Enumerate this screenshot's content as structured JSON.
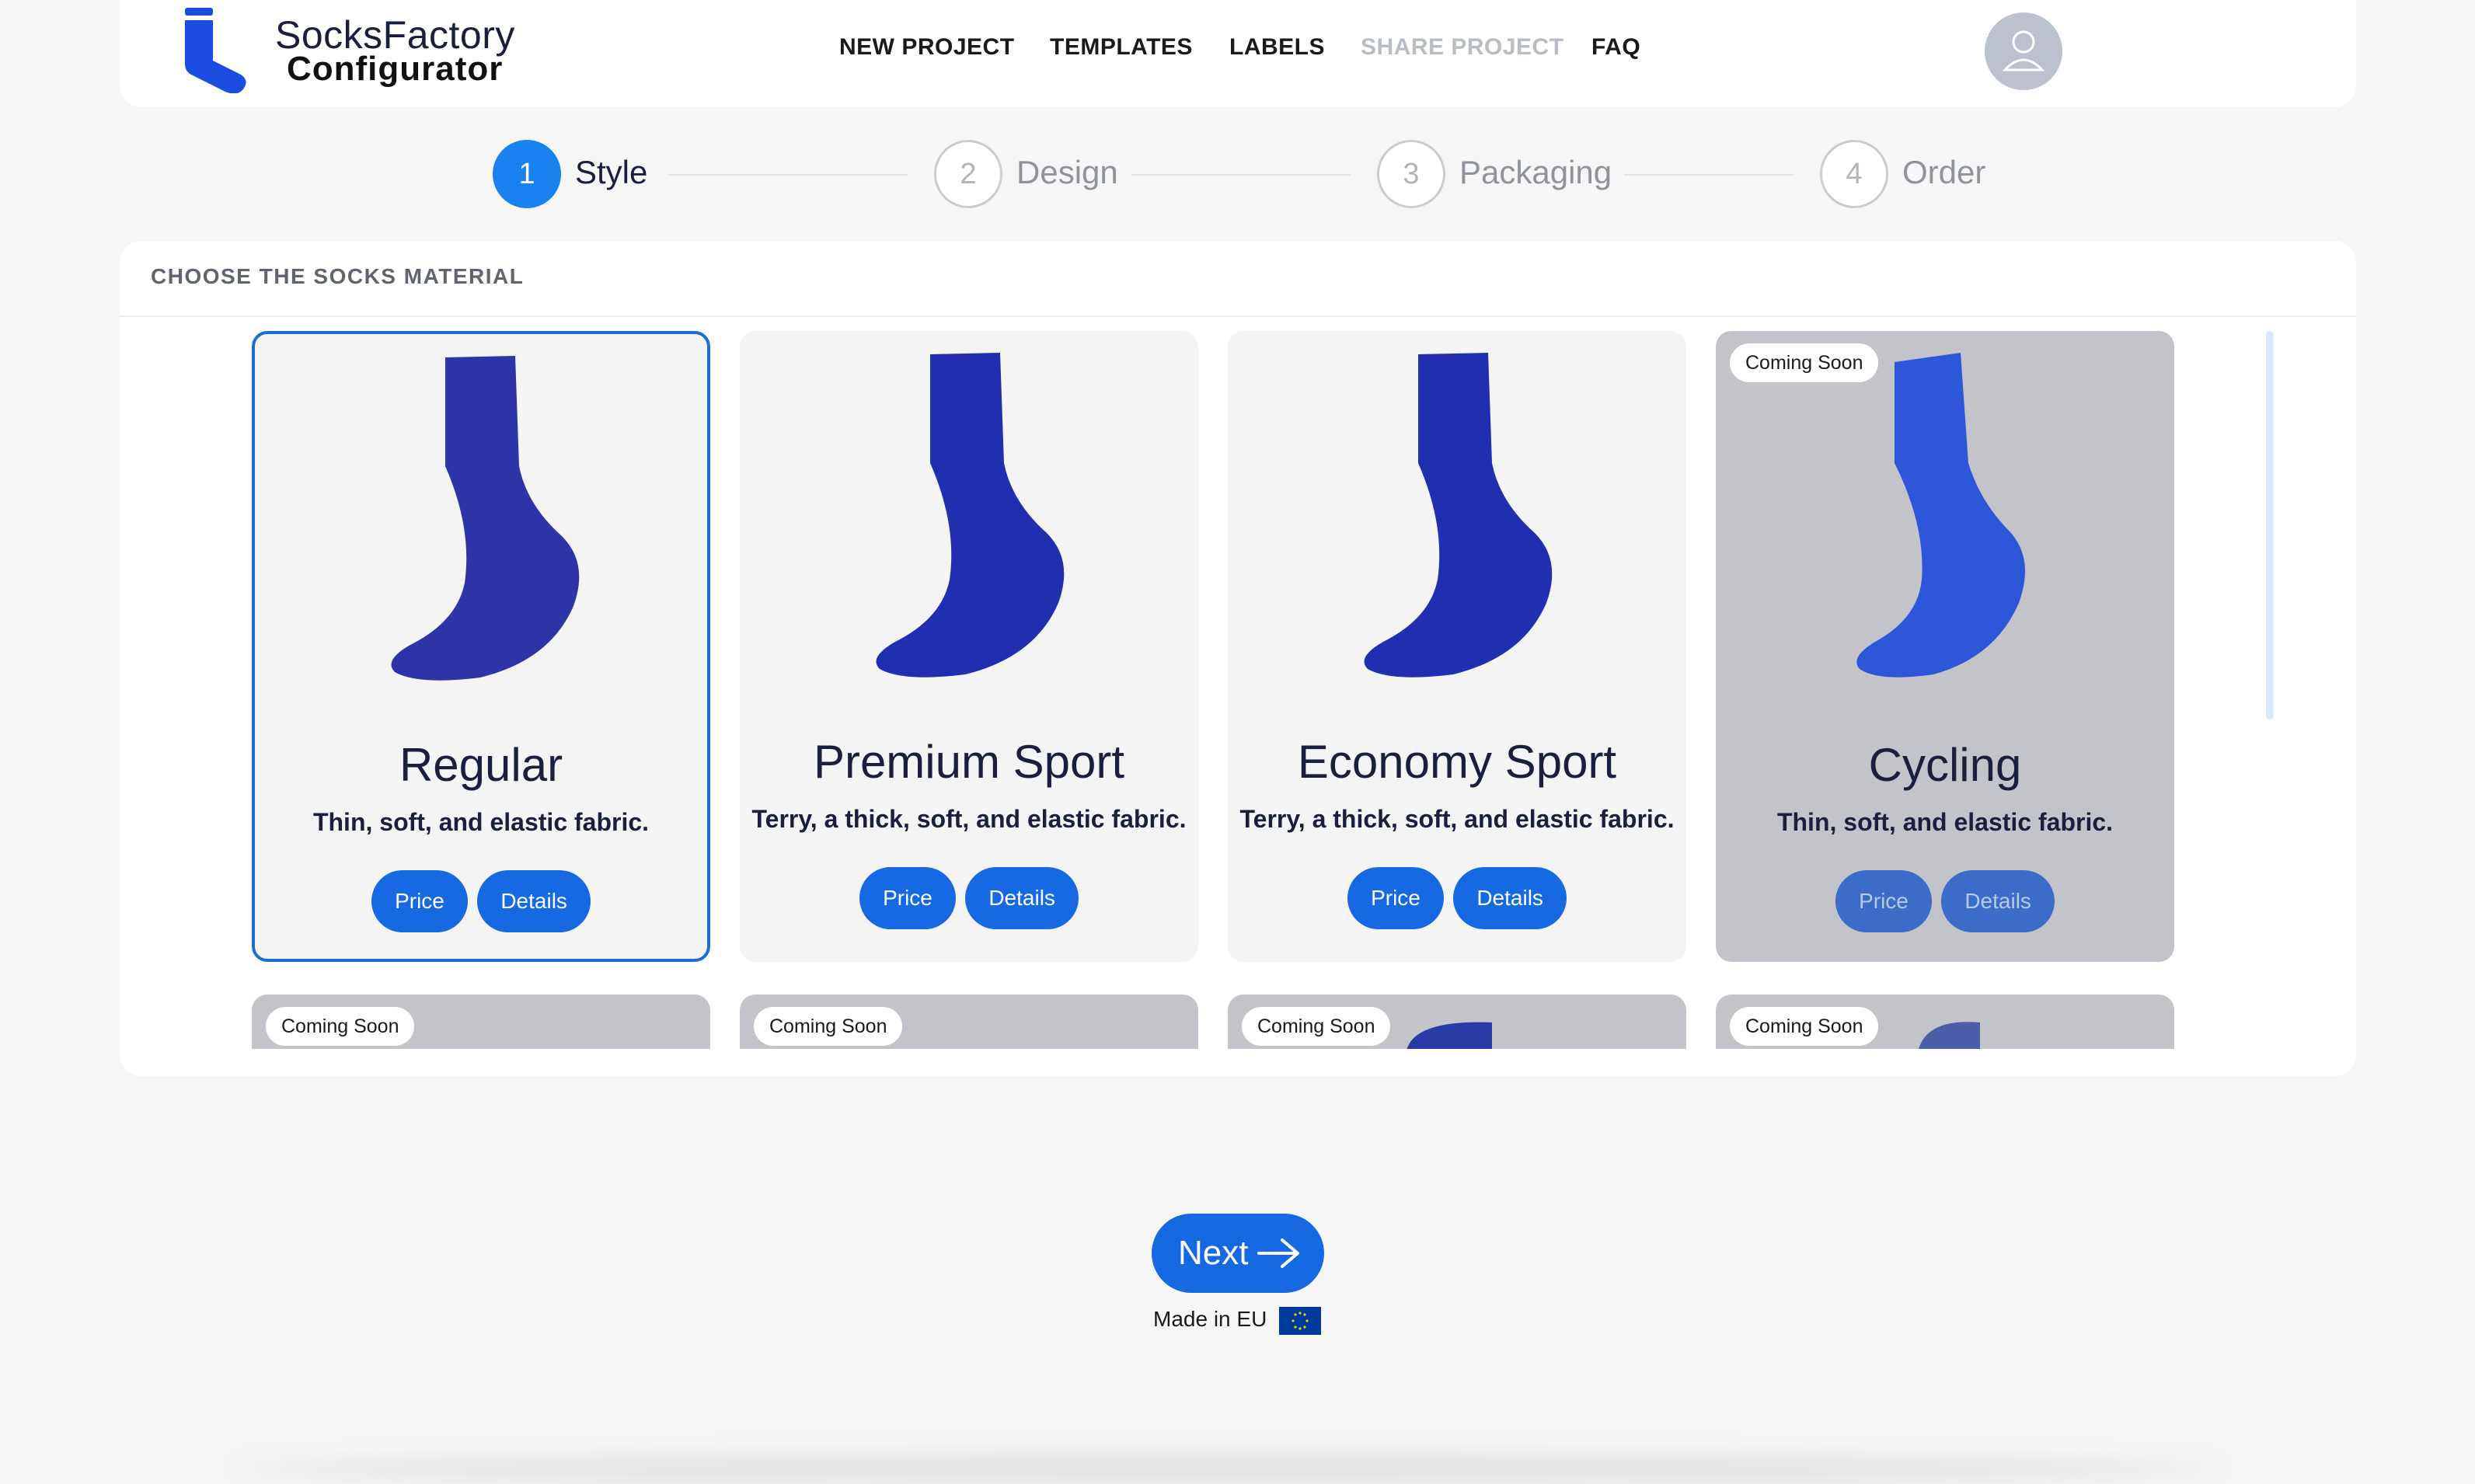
{
  "header": {
    "logo_line1": "SocksFactory",
    "logo_line2": "Configurator",
    "nav": [
      {
        "label": "NEW PROJECT",
        "enabled": true
      },
      {
        "label": "TEMPLATES",
        "enabled": true
      },
      {
        "label": "LABELS",
        "enabled": true
      },
      {
        "label": "SHARE PROJECT",
        "enabled": false
      },
      {
        "label": "FAQ",
        "enabled": true
      }
    ],
    "avatar_icon": "user-icon"
  },
  "stepper": [
    {
      "number": "1",
      "label": "Style",
      "active": true
    },
    {
      "number": "2",
      "label": "Design",
      "active": false
    },
    {
      "number": "3",
      "label": "Packaging",
      "active": false
    },
    {
      "number": "4",
      "label": "Order",
      "active": false
    }
  ],
  "panel": {
    "title": "CHOOSE THE SOCKS MATERIAL",
    "cards": [
      {
        "title": "Regular",
        "description": "Thin, soft, and elastic fabric.",
        "price_label": "Price",
        "details_label": "Details",
        "selected": true,
        "coming_soon": false,
        "color": "#2d34a8"
      },
      {
        "title": "Premium Sport",
        "description": "Terry, a thick, soft, and elastic fabric.",
        "price_label": "Price",
        "details_label": "Details",
        "selected": false,
        "coming_soon": false,
        "color": "#1f2fb0"
      },
      {
        "title": "Economy Sport",
        "description": "Terry, a thick, soft, and elastic fabric.",
        "price_label": "Price",
        "details_label": "Details",
        "selected": false,
        "coming_soon": false,
        "color": "#1f2fb0"
      },
      {
        "title": "Cycling",
        "description": "Thin, soft, and elastic fabric.",
        "price_label": "Price",
        "details_label": "Details",
        "selected": false,
        "coming_soon": true,
        "badge": "Coming Soon",
        "color": "#2e56d8"
      }
    ],
    "second_row_badges": [
      "Coming Soon",
      "Coming Soon",
      "Coming Soon",
      "Coming Soon"
    ]
  },
  "footer": {
    "next_label": "Next",
    "made_in": "Made in EU"
  },
  "colors": {
    "accent": "#1668e3",
    "active_step": "#1a82f0",
    "selected_border": "#1a6fd6"
  }
}
